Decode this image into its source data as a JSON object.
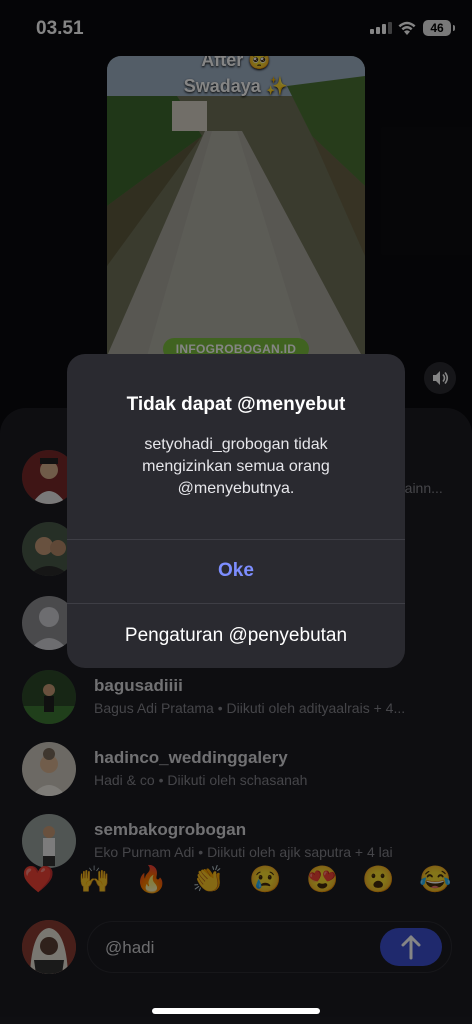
{
  "status": {
    "time": "03.51",
    "battery": "46"
  },
  "video": {
    "caption_top": "After 🥺",
    "caption_main": "Swadaya ✨",
    "watermark": "INFOGROBOGAN.ID"
  },
  "users": [
    {
      "username": "",
      "subtitle": "rainn..."
    },
    {
      "username": "",
      "subtitle": ""
    },
    {
      "username": "",
      "subtitle": ""
    },
    {
      "username": "bagusadiiii",
      "subtitle": "Bagus Adi Pratama • Diikuti oleh adityaalrais + 4..."
    },
    {
      "username": "hadinco_weddinggalery",
      "subtitle": "Hadi & co • Diikuti oleh schasanah"
    },
    {
      "username": "sembakogrobogan",
      "subtitle": "Eko Purnam Adi • Diikuti oleh ajik saputra + 4 lai"
    }
  ],
  "reactions": [
    "❤️",
    "🙌",
    "🔥",
    "👏",
    "😢",
    "😍",
    "😮",
    "😂"
  ],
  "composer": {
    "text": "@hadi"
  },
  "dialog": {
    "title": "Tidak dapat @menyebut",
    "message": "setyohadi_grobogan tidak mengizinkan semua orang @menyebutnya.",
    "ok_label": "Oke",
    "settings_label": "Pengaturan @penyebutan"
  },
  "colors": {
    "accent": "#7d8eff",
    "send_button": "#3c4fd1",
    "sheet": "#1c1c22"
  }
}
